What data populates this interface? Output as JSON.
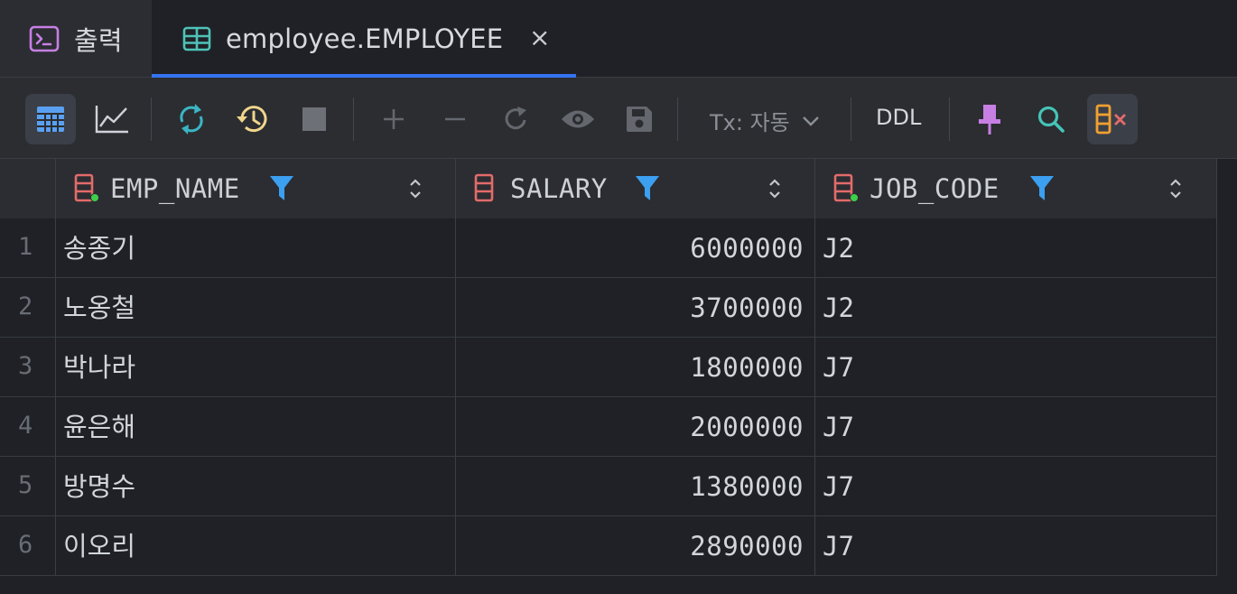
{
  "tabs": [
    {
      "label": "출력",
      "icon": "console-icon"
    },
    {
      "label": "employee.EMPLOYEE",
      "icon": "table-icon",
      "close": "×"
    }
  ],
  "toolbar": {
    "tx_label": "Tx: 자동",
    "ddl_label": "DDL"
  },
  "columns": [
    {
      "name": "EMP_NAME"
    },
    {
      "name": "SALARY"
    },
    {
      "name": "JOB_CODE"
    }
  ],
  "rows": [
    {
      "num": "1",
      "emp_name": "송종기",
      "salary": "6000000",
      "job_code": "J2"
    },
    {
      "num": "2",
      "emp_name": "노옹철",
      "salary": "3700000",
      "job_code": "J2"
    },
    {
      "num": "3",
      "emp_name": "박나라",
      "salary": "1800000",
      "job_code": "J7"
    },
    {
      "num": "4",
      "emp_name": "윤은해",
      "salary": "2000000",
      "job_code": "J7"
    },
    {
      "num": "5",
      "emp_name": "방명수",
      "salary": "1380000",
      "job_code": "J7"
    },
    {
      "num": "6",
      "emp_name": "이오리",
      "salary": "2890000",
      "job_code": "J7"
    }
  ],
  "colors": {
    "accent": "#3574f0",
    "filter_icon": "#3c9ff0",
    "key_icon": "#e36b6b",
    "refresh_icon": "#3bb5c4",
    "history_icon": "#f0d58c",
    "pin_icon": "#c77fe3",
    "search_icon": "#45c4b7",
    "remove_col_icon": "#f0a030"
  }
}
